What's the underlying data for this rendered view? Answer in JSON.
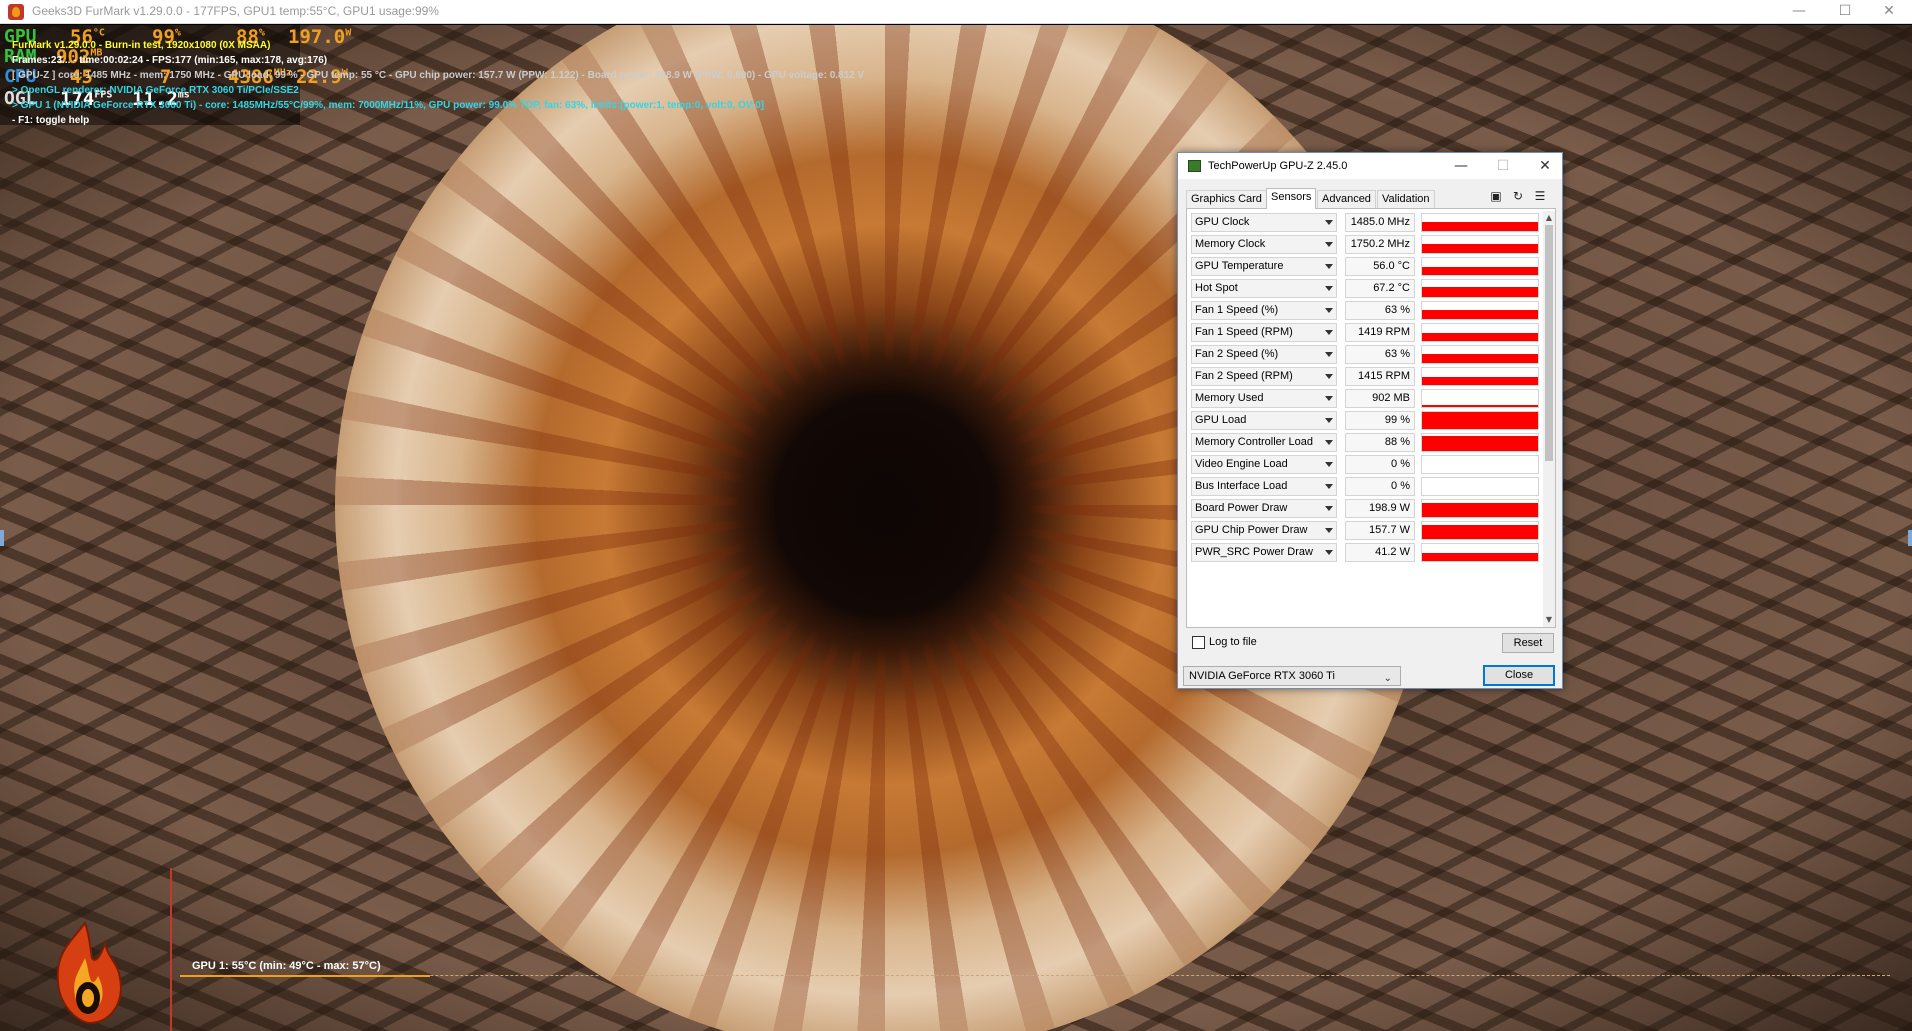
{
  "window": {
    "title": "Geeks3D FurMark v1.29.0.0 - 177FPS, GPU1 temp:55°C, GPU1 usage:99%",
    "min": "—",
    "max": "☐",
    "close": "✕"
  },
  "osd": {
    "gpu_label": "GPU",
    "gpu_temp": "56",
    "gpu_temp_unit": "°C",
    "gpu_usage": "99",
    "gpu_usage_unit": "%",
    "gpu_mem_ctrl": "88",
    "gpu_mem_ctrl_unit": "%",
    "gpu_power": "197.0",
    "gpu_power_unit": "W",
    "ram_label": "RAM",
    "ram_used": "902",
    "ram_unit": "MB",
    "cpu_label": "CPU",
    "cpu_val1": "45",
    "cpu_val2": "7",
    "cpu_val3": "4386",
    "cpu_val3_unit": "MHz",
    "cpu_val4": "22.9",
    "cpu_val4_unit": "W",
    "ogl_label": "OGL",
    "fps": "174",
    "fps_unit": "FPS",
    "frametime": "11.2",
    "frametime_unit": "ms",
    "line1": "FurMark v1.29.0.0 - Burn-in test, 1920x1080 (0X MSAA)",
    "line2": "Frames:23... - time:00:02:24 - FPS:177 (min:165, max:178, avg:176)",
    "line3": "[ GPU-Z ] core: 1485 MHz - mem: 1750 MHz - GPU load: 99 % - GPU temp: 55 °C - GPU chip power: 157.7 W (PPW: 1.122) - Board power: 198.9 W (PPW: 0.890) - GPU voltage: 0.812 V",
    "line4": "> OpenGL renderer: NVIDIA GeForce RTX 3060 Ti/PCIe/SSE2",
    "line5": "> GPU 1 (NVIDIA GeForce RTX 3060 Ti) - core: 1485MHz/55°C/99%, mem: 7000MHz/11%, GPU power: 99.0% TDP, fan: 63%, limits:[power:1, temp:0, volt:0, OV:0]",
    "line6": "- F1: toggle help",
    "graph_label": "GPU 1: 55°C (min: 49°C - max: 57°C)"
  },
  "gpuz": {
    "title": "TechPowerUp GPU-Z 2.45.0",
    "tabs": [
      {
        "label": "Graphics Card"
      },
      {
        "label": "Sensors"
      },
      {
        "label": "Advanced"
      },
      {
        "label": "Validation"
      }
    ],
    "active_tab": "Sensors",
    "icons": {
      "camera": "camera-icon",
      "refresh": "refresh-icon",
      "menu": "menu-icon"
    },
    "sensors": [
      {
        "name": "GPU Clock",
        "value": "1485.0 MHz",
        "level": 0.55
      },
      {
        "name": "Memory Clock",
        "value": "1750.2 MHz",
        "level": 0.55
      },
      {
        "name": "GPU Temperature",
        "value": "56.0 °C",
        "level": 0.5
      },
      {
        "name": "Hot Spot",
        "value": "67.2 °C",
        "level": 0.6
      },
      {
        "name": "Fan 1 Speed (%)",
        "value": "63 %",
        "level": 0.55
      },
      {
        "name": "Fan 1 Speed (RPM)",
        "value": "1419 RPM",
        "level": 0.45
      },
      {
        "name": "Fan 2 Speed (%)",
        "value": "63 %",
        "level": 0.55
      },
      {
        "name": "Fan 2 Speed (RPM)",
        "value": "1415 RPM",
        "level": 0.45
      },
      {
        "name": "Memory Used",
        "value": "902 MB",
        "level": 0.12
      },
      {
        "name": "GPU Load",
        "value": "99 %",
        "level": 0.99
      },
      {
        "name": "Memory Controller Load",
        "value": "88 %",
        "level": 0.88
      },
      {
        "name": "Video Engine Load",
        "value": "0 %",
        "level": 0
      },
      {
        "name": "Bus Interface Load",
        "value": "0 %",
        "level": 0
      },
      {
        "name": "Board Power Draw",
        "value": "198.9 W",
        "level": 0.85
      },
      {
        "name": "GPU Chip Power Draw",
        "value": "157.7 W",
        "level": 0.8
      },
      {
        "name": "PWR_SRC Power Draw",
        "value": "41.2 W",
        "level": 0.5
      }
    ],
    "log_label": "Log to file",
    "reset_label": "Reset",
    "gpu_select": "NVIDIA GeForce RTX 3060 Ti",
    "close_label": "Close"
  }
}
